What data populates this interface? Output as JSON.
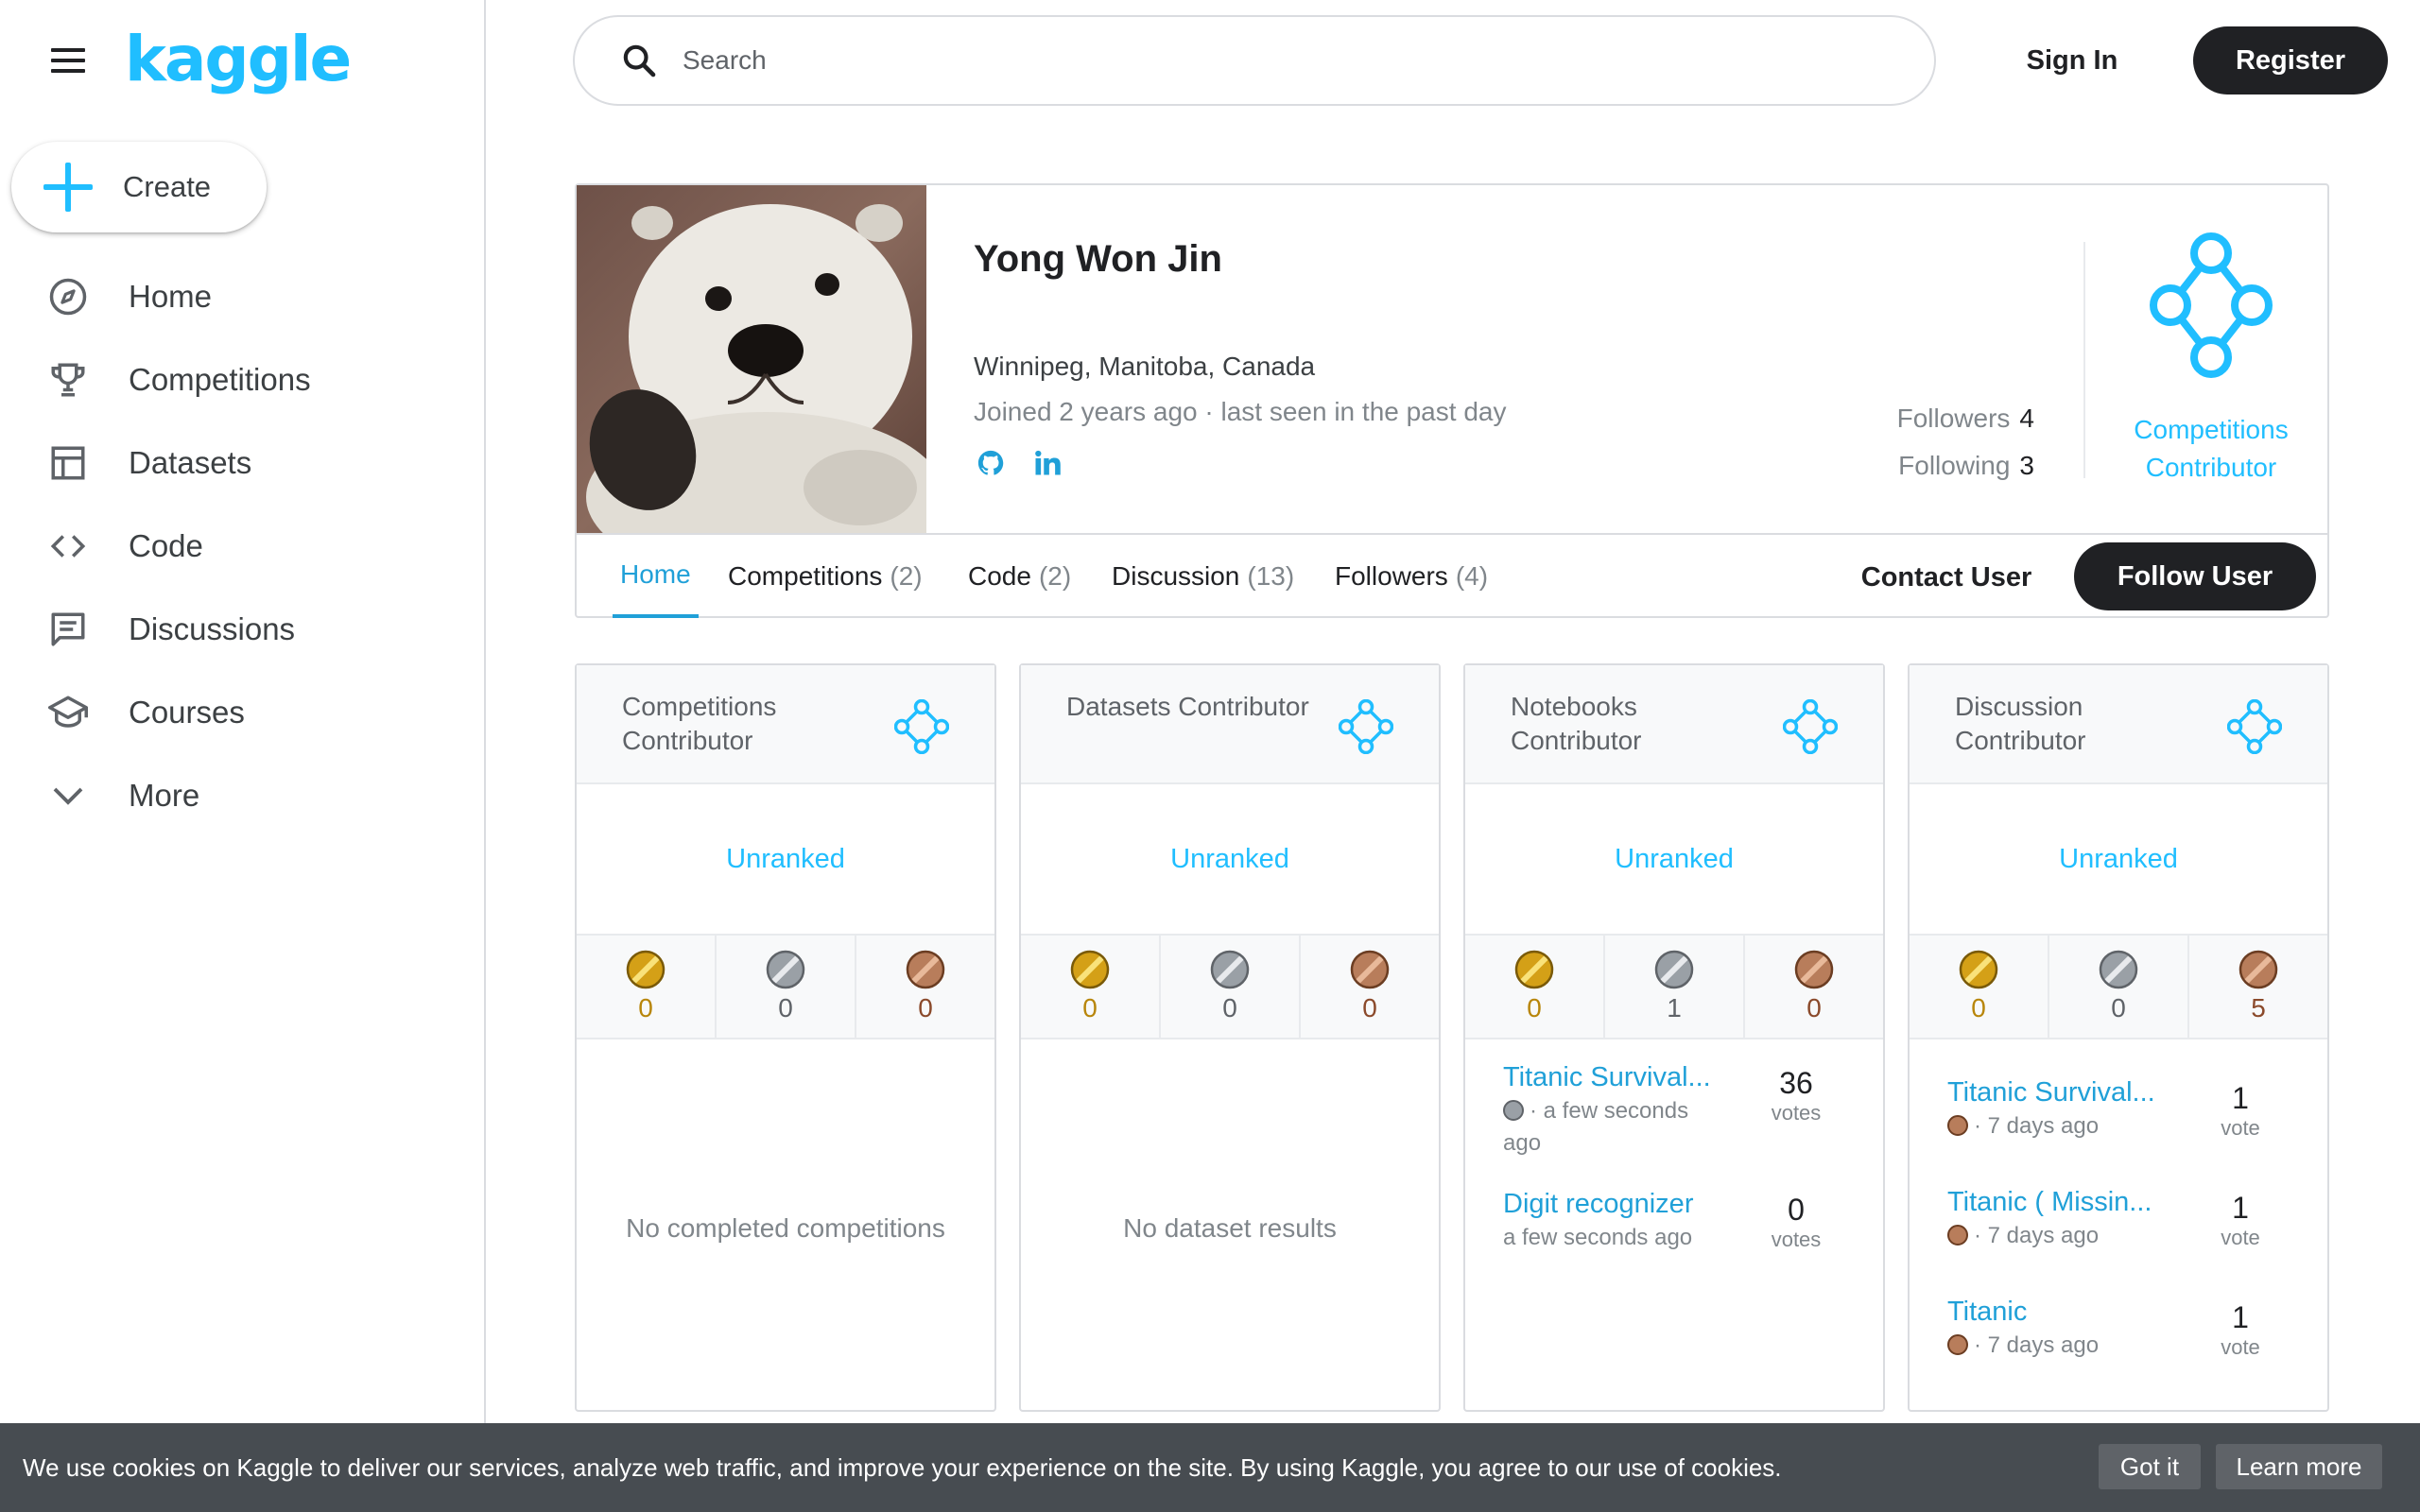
{
  "brand": {
    "logo_text": "kaggle",
    "accent": "#20beff",
    "dark": "#202124"
  },
  "sidebar": {
    "create_label": "Create",
    "items": [
      {
        "label": "Home",
        "icon": "compass-icon"
      },
      {
        "label": "Competitions",
        "icon": "trophy-icon"
      },
      {
        "label": "Datasets",
        "icon": "table-icon"
      },
      {
        "label": "Code",
        "icon": "code-icon"
      },
      {
        "label": "Discussions",
        "icon": "comment-icon"
      },
      {
        "label": "Courses",
        "icon": "school-icon"
      },
      {
        "label": "More",
        "icon": "chevron-down-icon"
      }
    ]
  },
  "topbar": {
    "search_placeholder": "Search",
    "signin_label": "Sign In",
    "register_label": "Register"
  },
  "profile": {
    "name": "Yong Won Jin",
    "location": "Winnipeg, Manitoba, Canada",
    "joined": "Joined 2 years ago · last seen in the past day",
    "followers_label": "Followers",
    "followers_count": "4",
    "following_label": "Following",
    "following_count": "3",
    "tier_label": "Competitions Contributor",
    "tabs": [
      {
        "label": "Home",
        "count": ""
      },
      {
        "label": "Competitions",
        "count": "(2)"
      },
      {
        "label": "Code",
        "count": "(2)"
      },
      {
        "label": "Discussion",
        "count": "(13)"
      },
      {
        "label": "Followers",
        "count": "(4)"
      }
    ],
    "contact_label": "Contact User",
    "follow_label": "Follow User"
  },
  "medal_colors": {
    "gold": "#d4a017",
    "silver": "#9aa0a6",
    "bronze": "#b87d5b"
  },
  "cards": [
    {
      "title": "Competitions Contributor",
      "rank": "Unranked",
      "medals": {
        "gold": "0",
        "silver": "0",
        "bronze": "0"
      },
      "empty": "No completed competitions"
    },
    {
      "title": "Datasets Contributor",
      "rank": "Unranked",
      "medals": {
        "gold": "0",
        "silver": "0",
        "bronze": "0"
      },
      "empty": "No dataset results"
    },
    {
      "title": "Notebooks Contributor",
      "rank": "Unranked",
      "medals": {
        "gold": "0",
        "silver": "1",
        "bronze": "0"
      },
      "items": [
        {
          "title": "Titanic Survival...",
          "meta": "· a few seconds ago",
          "medal": "silver",
          "votes": "36",
          "votes_label": "votes"
        },
        {
          "title": "Digit recognizer",
          "meta": "a few seconds ago",
          "medal": "",
          "votes": "0",
          "votes_label": "votes"
        }
      ]
    },
    {
      "title": "Discussion Contributor",
      "rank": "Unranked",
      "medals": {
        "gold": "0",
        "silver": "0",
        "bronze": "5"
      },
      "items": [
        {
          "title": "Titanic Survival...",
          "meta": "· 7 days ago",
          "medal": "bronze",
          "votes": "1",
          "votes_label": "vote"
        },
        {
          "title": "Titanic ( Missin...",
          "meta": "· 7 days ago",
          "medal": "bronze",
          "votes": "1",
          "votes_label": "vote"
        },
        {
          "title": "Titanic",
          "meta": "· 7 days ago",
          "medal": "bronze",
          "votes": "1",
          "votes_label": "vote"
        }
      ]
    }
  ],
  "cookie": {
    "text": "We use cookies on Kaggle to deliver our services, analyze web traffic, and improve your experience on the site. By using Kaggle, you agree to our use of cookies.",
    "got_it": "Got it",
    "learn_more": "Learn more"
  }
}
